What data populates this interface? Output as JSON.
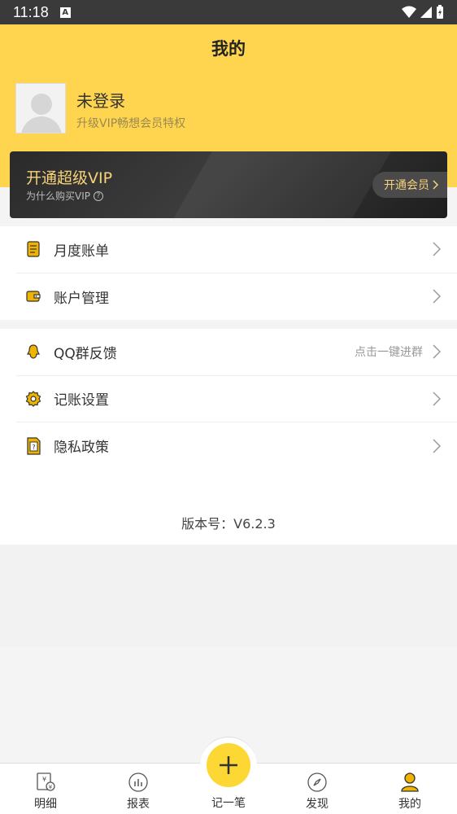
{
  "status_bar": {
    "time": "11:18",
    "badge": "A"
  },
  "header": {
    "title": "我的"
  },
  "user": {
    "name": "未登录",
    "subtitle": "升级VIP畅想会员特权"
  },
  "vip": {
    "title": "开通超级VIP",
    "subtitle": "为什么购买VIP",
    "button_label": "开通会员"
  },
  "menu_group_1": [
    {
      "label": "月度账单",
      "icon": "bill-icon"
    },
    {
      "label": "账户管理",
      "icon": "wallet-icon"
    }
  ],
  "menu_group_2": [
    {
      "label": "QQ群反馈",
      "icon": "qq-icon",
      "hint": "点击一键进群"
    },
    {
      "label": "记账设置",
      "icon": "gear-icon"
    },
    {
      "label": "隐私政策",
      "icon": "privacy-icon"
    }
  ],
  "version": "版本号：V6.2.3",
  "tabs": [
    {
      "label": "明细",
      "icon": "detail-icon"
    },
    {
      "label": "报表",
      "icon": "report-icon"
    },
    {
      "label": "记一笔",
      "icon": "plus-icon"
    },
    {
      "label": "发现",
      "icon": "compass-icon"
    },
    {
      "label": "我的",
      "icon": "user-icon",
      "active": true
    }
  ],
  "colors": {
    "accent": "#ffd54f",
    "fab": "#fdd835",
    "vip_gold": "#f7d37a",
    "icon_gold": "#f0b400"
  }
}
